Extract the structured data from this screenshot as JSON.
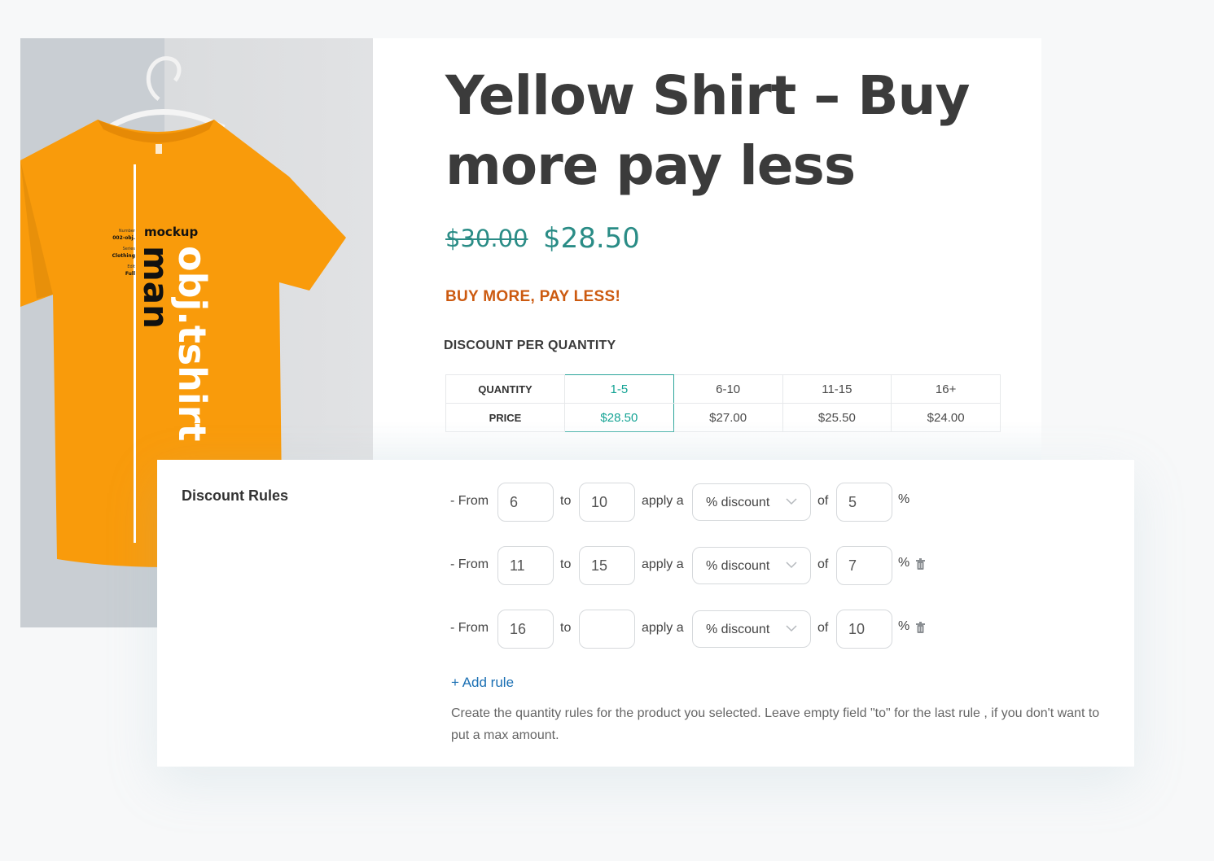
{
  "product": {
    "title": "Yellow Shirt – Buy more pay less",
    "price_old": "$30.00",
    "price_new": "$28.50",
    "promo_heading": "BUY MORE, PAY LESS!",
    "discount_heading": "DISCOUNT PER QUANTITY",
    "image": {
      "alt_text_visible": [
        "mockup",
        "man",
        "obj.tshirt",
        "Number",
        "002-obj.",
        "Series",
        "Clothing",
        "Edit",
        "Full"
      ],
      "shirt_color": "#f99b0b"
    },
    "quantity_table": {
      "row_labels": [
        "QUANTITY",
        "PRICE"
      ],
      "tiers": [
        {
          "quantity": "1-5",
          "price": "$28.50",
          "active": true
        },
        {
          "quantity": "6-10",
          "price": "$27.00",
          "active": false
        },
        {
          "quantity": "11-15",
          "price": "$25.50",
          "active": false
        },
        {
          "quantity": "16+",
          "price": "$24.00",
          "active": false
        }
      ]
    }
  },
  "rules_panel": {
    "label": "Discount Rules",
    "from_label": "- From",
    "to_label": "to",
    "apply_label": "apply a",
    "of_label": "of",
    "percent_label": "%",
    "rules": [
      {
        "from": "6",
        "to": "10",
        "type": "% discount",
        "amount": "5",
        "deletable": false
      },
      {
        "from": "11",
        "to": "15",
        "type": "% discount",
        "amount": "7",
        "deletable": true
      },
      {
        "from": "16",
        "to": "",
        "type": "% discount",
        "amount": "10",
        "deletable": true
      }
    ],
    "add_rule": "+ Add rule",
    "help_text": "Create the quantity rules for the product you selected. Leave empty field \"to\" for the last rule , if you don't want to put a max amount."
  },
  "colors": {
    "accent_teal": "#2a8c86",
    "promo_orange": "#cc5a10",
    "link_blue": "#1a6fb3",
    "title_dark": "#3b3b3b"
  }
}
